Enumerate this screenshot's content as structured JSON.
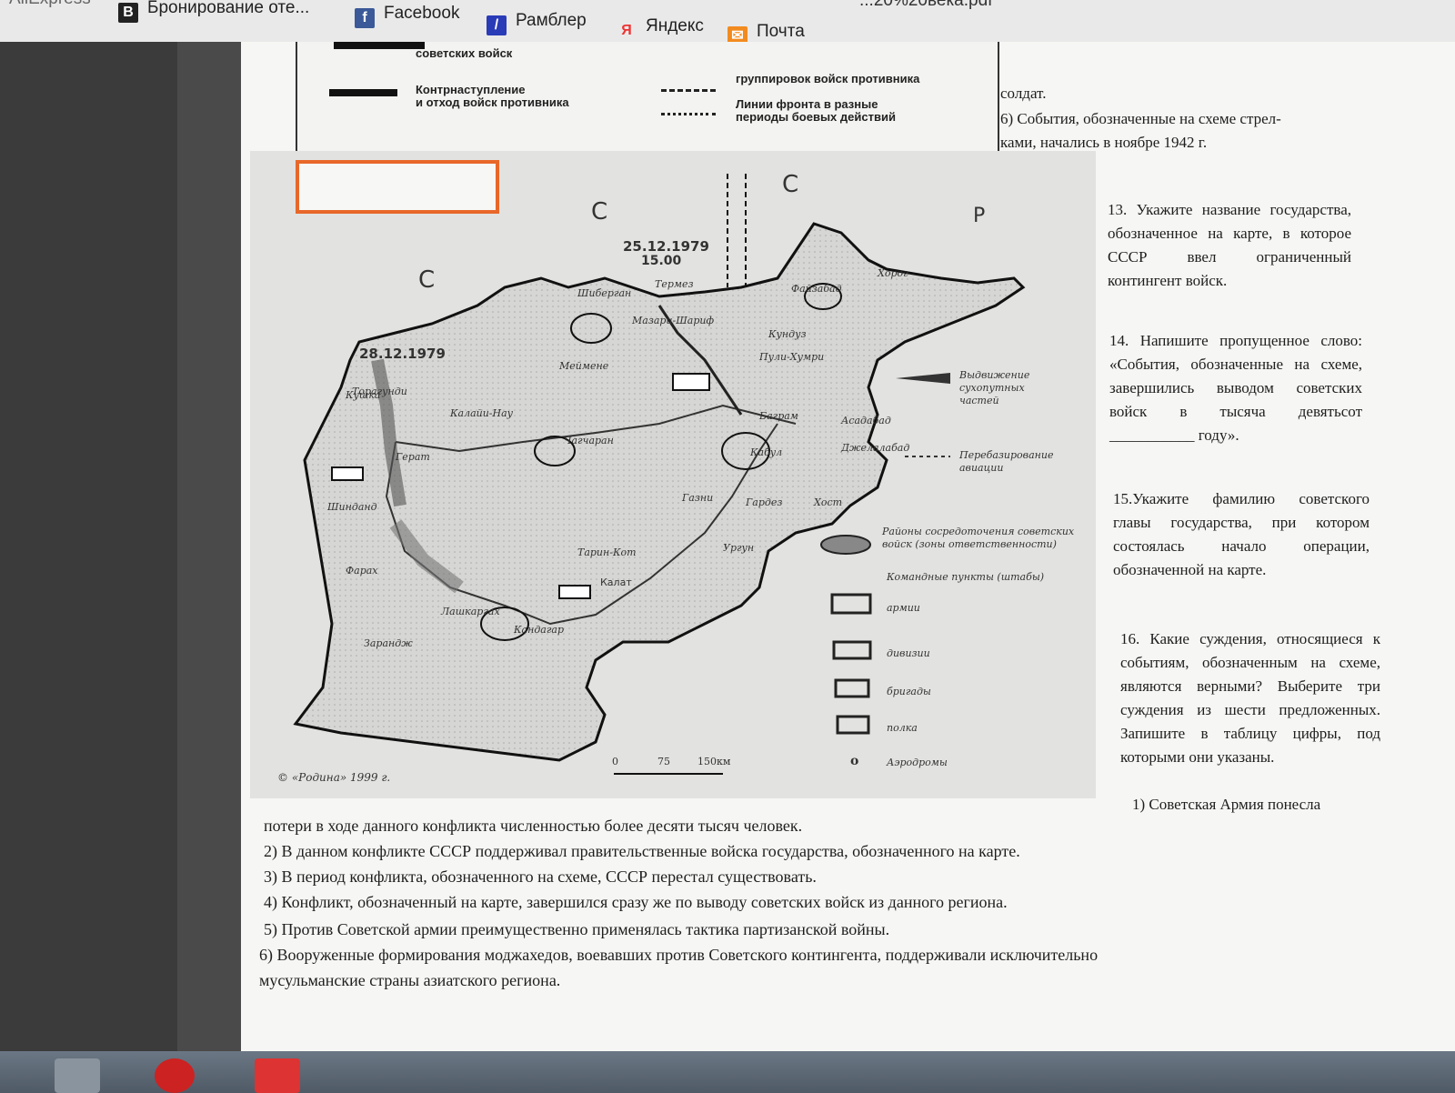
{
  "bookmarks": {
    "items": [
      {
        "label": "AliExpress"
      },
      {
        "label": "Бронирование оте..."
      },
      {
        "label": "Facebook"
      },
      {
        "label": "Рамблер"
      },
      {
        "label": "Яндекс"
      },
      {
        "label": "Почта"
      }
    ],
    "pdf_name": "...20%20века.pdf"
  },
  "legend_top": {
    "soviet_troops": "советских войск",
    "counter": "Контрнаступление\nи отход войск противника",
    "enemy_groups": "группировок войск противника",
    "front_lines": "Линии фронта в разные\nпериоды боевых действий"
  },
  "right_top": {
    "line1": "солдат.",
    "line2": "6) События, обозначенные на схеме стрел-",
    "line3": "ками, начались в ноябре 1942 г."
  },
  "questions": {
    "q13": "13. Укажите название государства, обозначенное на карте, в которое СССР ввел ограниченный контингент войск.",
    "q14": "14. Напишите пропущенное слово: «События, обозначенные на схеме, завершились выводом советских войск в тысяча девятьсот ___________ году».",
    "q15": "15.Укажите фамилию советского главы государства, при котором состоялась начало операции, обозначенной на карте.",
    "q16": "16. Какие суждения, относящиеся к событиям, обозначенным на схеме, являются верными? Выберите три суждения из шести предложенных. Запишите в таблицу цифры, под которыми они указаны.",
    "opt1_start": "1) Советская Армия понесла"
  },
  "map": {
    "date1": "25.12.1979",
    "time1": "15.00",
    "date2": "28.12.1979",
    "letters": [
      "С",
      "С",
      "С",
      "Р"
    ],
    "copyright": "© «Родина» 1999 г.",
    "scale": [
      "0",
      "75",
      "150км"
    ],
    "legend": {
      "advance": "Выдвижение сухопутных частей",
      "airlift": "Перебазирование авиации",
      "areas": "Районы сосредоточения советских войск (зоны ответственности)",
      "command": "Командные пункты (штабы)",
      "army": "армии",
      "division": "дивизии",
      "brigade": "бригады",
      "regiment": "полка",
      "airfield": "Аэродромы"
    },
    "places": [
      "Термез",
      "Кушка",
      "Герат",
      "Шинданд",
      "Кандагар",
      "Кабул",
      "Баграм",
      "Джелалабад",
      "Кундуз",
      "Мазари-Шариф",
      "Файзабад",
      "Газни",
      "Фарах",
      "Калат",
      "Тарин-Кот",
      "Чагчаран",
      "Калайи-Нау",
      "Лашкаргах",
      "Зарандж",
      "Гардез",
      "Хост",
      "Меймене",
      "Шиберган",
      "Пули-Хумри",
      "Хорог",
      "Асадабад",
      "Торагунди",
      "Ургун"
    ]
  },
  "bottom": {
    "l1": "потери в ходе данного конфликта численностью более десяти тысяч человек.",
    "l2": "2) В данном конфликте СССР поддерживал правительственные войска государства, обозначенного на карте.",
    "l3": "3) В период конфликта, обозначенного на схеме, СССР перестал существовать.",
    "l4": "4) Конфликт, обозначенный на карте, завершился сразу же по выводу советских войск из данного региона.",
    "l5": "5) Против Советской армии преимущественно применялась тактика партизанской войны.",
    "l6a": "6) Вооруженные формирования моджахедов, воевавших против Советского контингента, поддерживали исключительно",
    "l6b": "мусульманские страны азиатского региона."
  },
  "colors": {
    "highlight_box": "#e8682a",
    "page": "#f6f6f4",
    "taskbar": "#5a6570"
  }
}
